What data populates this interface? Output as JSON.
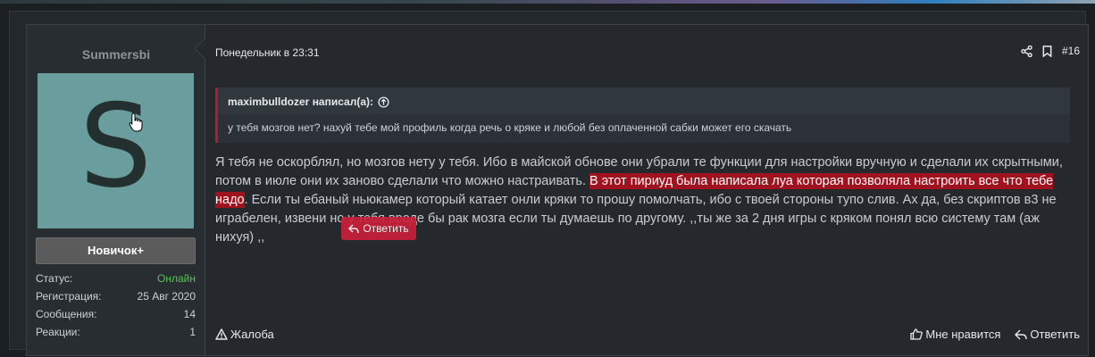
{
  "author": {
    "username": "Summersbi",
    "avatar_letter": "S",
    "avatar_color": "#6a9e9e",
    "rank": "Новичок+",
    "stats": [
      {
        "label": "Статус:",
        "value": "Онлайн"
      },
      {
        "label": "Регистрация:",
        "value": "25 Авг 2020"
      },
      {
        "label": "Сообщения:",
        "value": "14"
      },
      {
        "label": "Реакции:",
        "value": "1"
      }
    ]
  },
  "post": {
    "date": "Понедельник в 23:31",
    "number": "#16",
    "quote": {
      "author": "maximbulldozer написал(а):",
      "text": "у тебя мозгов нет? нахуй тебе мой профиль когда речь о кряке и любой без оплаченной сабки может его скачать"
    },
    "message": {
      "part1": "Я тебя не оскорблял, но мозгов нету у тебя. Ибо в майской обнове они убрали те функции для настройки вручную и сделали их скрытными, потом в июле они их заново сделали что можно настраивать. ",
      "highlight": "В этот пириуд была написала луа которая позволяла настроить все что тебе надо",
      "part2": ". Если ты ебаный ньюкамер который катает онли кряки то прошу помолчать, ибо с твоей стороны тупо слив. Ах да, без скриптов в3 не играбелен, извени но у тебя вроде бы рак мозга если ты думаешь по другому. ,,ты же за 2 дня игры с кряком понял всю систему там (аж нихуя) ,,"
    },
    "reply_popup": "Ответить",
    "footer": {
      "report": "Жалоба",
      "like": "Мне нравится",
      "reply": "Ответить"
    }
  },
  "colors": {
    "accent": "#b31b2e",
    "highlight": "#a1121f",
    "online": "#56c456"
  }
}
